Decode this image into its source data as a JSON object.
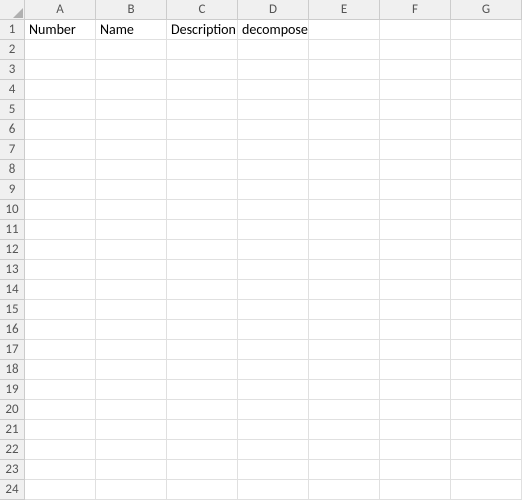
{
  "columns": [
    "A",
    "B",
    "C",
    "D",
    "E",
    "F",
    "G"
  ],
  "row_count": 24,
  "cells": {
    "A1": "Number",
    "B1": "Name",
    "C1": "Description",
    "D1": "decomposes"
  }
}
